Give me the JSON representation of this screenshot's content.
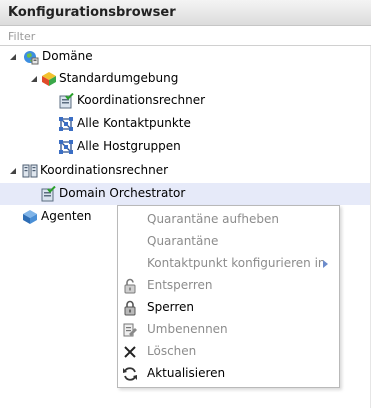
{
  "header": {
    "title": "Konfigurationsbrowser"
  },
  "filter": {
    "placeholder": "Filter",
    "value": ""
  },
  "tree": {
    "domaene": "Domäne",
    "standardumgebung": "Standardumgebung",
    "koordinationsrechner_item": "Koordinationsrechner",
    "alle_kontaktpunkte": "Alle Kontaktpunkte",
    "alle_hostgruppen": "Alle Hostgruppen",
    "koordinationsrechner_group": "Koordinationsrechner",
    "domain_orchestrator": "Domain Orchestrator",
    "agenten": "Agenten"
  },
  "context_menu": {
    "items": [
      {
        "label": "Quarantäne aufheben",
        "enabled": false,
        "icon": ""
      },
      {
        "label": "Quarantäne",
        "enabled": false,
        "icon": ""
      },
      {
        "label": "Kontaktpunkt konfigurieren in",
        "enabled": false,
        "icon": "",
        "submenu": true
      },
      {
        "label": "Entsperren",
        "enabled": false,
        "icon": "unlock-icon"
      },
      {
        "label": "Sperren",
        "enabled": true,
        "icon": "lock-icon"
      },
      {
        "label": "Umbenennen",
        "enabled": false,
        "icon": "rename-icon"
      },
      {
        "label": "Löschen",
        "enabled": false,
        "icon": "delete-icon"
      },
      {
        "label": "Aktualisieren",
        "enabled": true,
        "icon": "refresh-icon"
      }
    ]
  },
  "colors": {
    "selection": "#e6eaf9",
    "submenu_arrow": "#6d8ccb",
    "disabled_text": "#8c8c8c"
  }
}
